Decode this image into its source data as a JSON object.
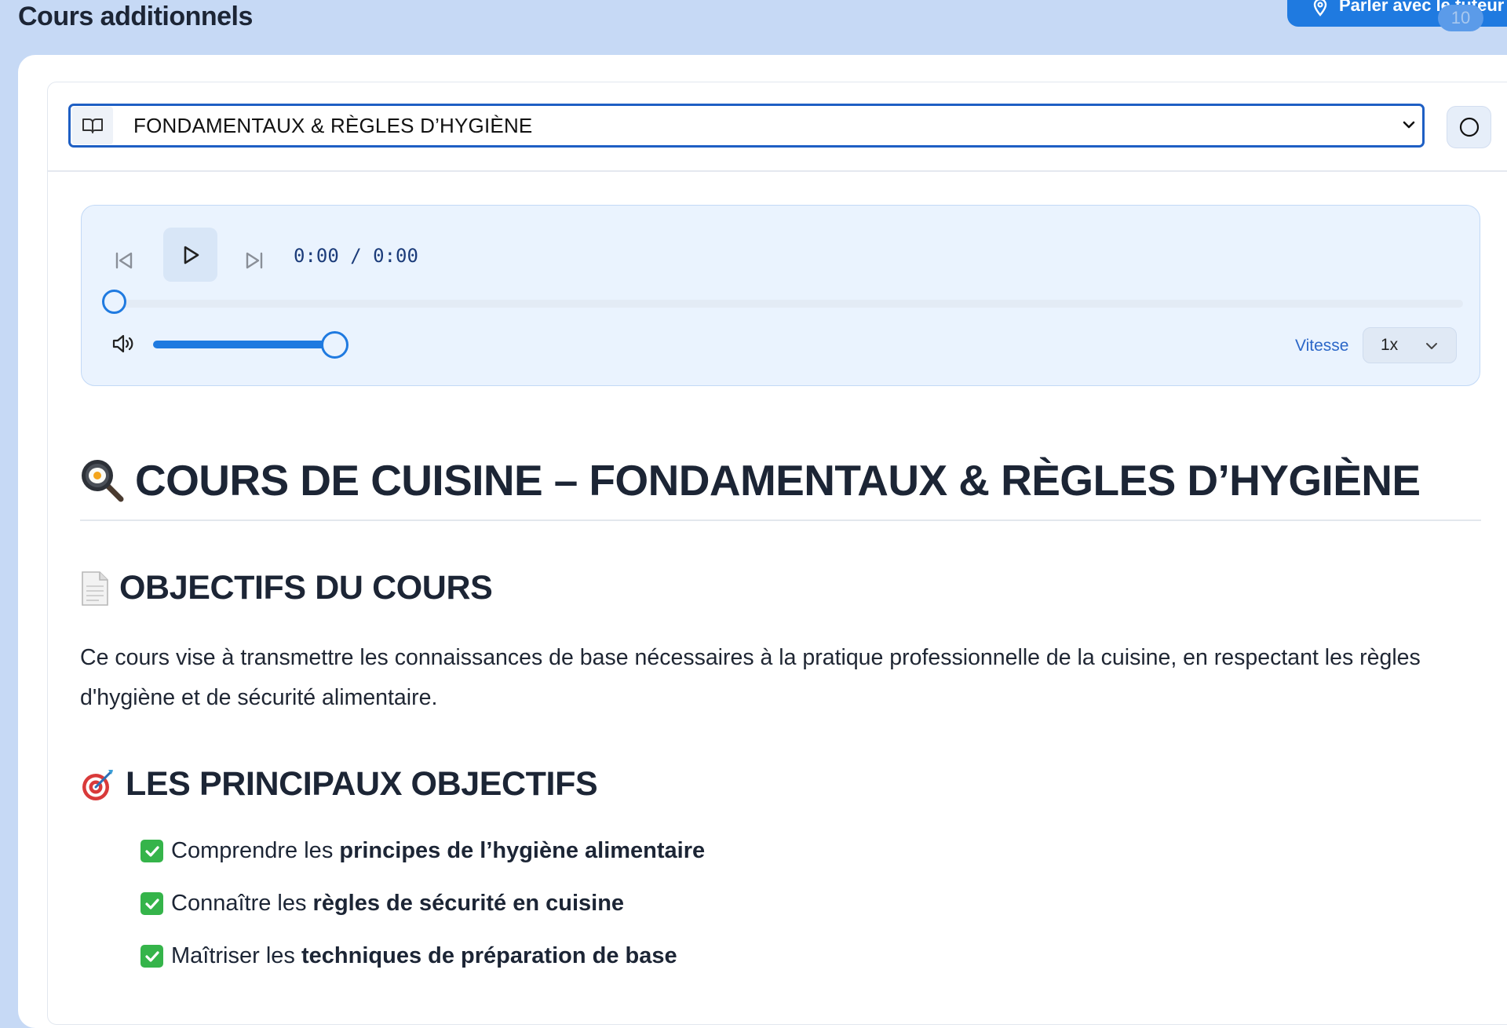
{
  "header": {
    "title": "Cours additionnels",
    "tutor_button_label": "Parler avec le tuteur",
    "tutor_badge": "10"
  },
  "course_select": {
    "selected": "FONDAMENTAUX & RÈGLES D’HYGIÈNE"
  },
  "player": {
    "time": "0:00 / 0:00",
    "progress": 0,
    "volume": 0.82,
    "speed_label": "Vitesse",
    "speed_value": "1x"
  },
  "content": {
    "title": "COURS DE CUISINE – FONDAMENTAUX & RÈGLES D’HYGIÈNE",
    "section1_title": "OBJECTIFS DU COURS",
    "section1_text": "Ce cours vise à transmettre les connaissances de base nécessaires à la pratique professionnelle de la cuisine, en respectant les règles d'hygiène et de sécurité alimentaire.",
    "section2_title": "LES PRINCIPAUX OBJECTIFS",
    "objectives": [
      {
        "prefix": "Comprendre les ",
        "bold": "principes de l’hygiène alimentaire"
      },
      {
        "prefix": "Connaître les ",
        "bold": "règles de sécurité en cuisine"
      },
      {
        "prefix": "Maîtriser les ",
        "bold": "techniques de préparation de base"
      }
    ]
  },
  "colors": {
    "background": "#c6d9f5",
    "accent": "#1f7ae0",
    "check": "#35b44a"
  },
  "icons": [
    "location-pin-icon",
    "book-icon",
    "chevron-down-icon",
    "circle-icon",
    "skip-back-icon",
    "play-icon",
    "skip-forward-icon",
    "volume-icon",
    "frying-pan-icon",
    "page-icon",
    "target-icon",
    "checkmark-icon"
  ]
}
